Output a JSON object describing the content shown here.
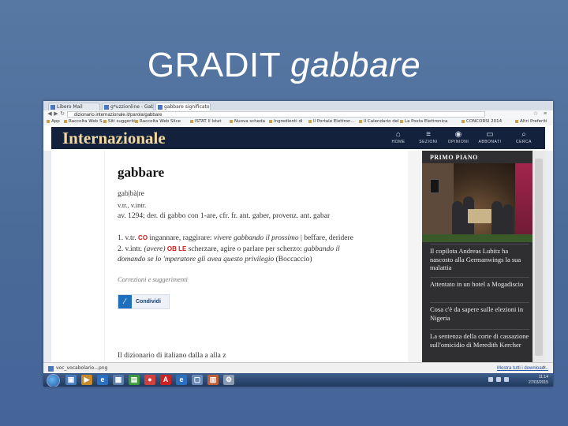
{
  "slide": {
    "title_main": "GRADIT",
    "title_italic": "gabbare"
  },
  "browser": {
    "tabs": [
      {
        "label": "Libero Mail"
      },
      {
        "label": "g*uzzionline - Gab"
      },
      {
        "label": "gabbare significato"
      }
    ],
    "url": "dizionario.internazionale.it/parola/gabbare",
    "bookmarks": [
      "App",
      "Raccolta Web S...",
      "Siti suggeriti",
      "Raccolta Web Slice",
      "ISTAT Il Istat",
      "Nuova scheda",
      "Ingredienti di",
      "Il Portale Elettron...",
      "Il Calendario del",
      "La Posta Elettronica",
      "CONCORSI 2014",
      "Altri Preferiti"
    ]
  },
  "site": {
    "logo": "Internazionale",
    "nav": [
      {
        "label": "HOME",
        "icon": "home-icon",
        "glyph": "⌂"
      },
      {
        "label": "SEZIONI",
        "icon": "menu-icon",
        "glyph": "≡"
      },
      {
        "label": "OPINIONI",
        "icon": "megaphone-icon",
        "glyph": "◉"
      },
      {
        "label": "ABBONATI",
        "icon": "bag-icon",
        "glyph": "▭"
      },
      {
        "label": "CERCA",
        "icon": "search-icon",
        "glyph": "⌕"
      }
    ]
  },
  "article": {
    "headword": "gabbare",
    "pronunciation": "gab|bà|re",
    "grammar": "v.tr., v.intr.",
    "etymology": "av. 1294; der. di gabbo con 1-are, cfr. fr. ant. gaber, provenz. ant. gabar",
    "def1_num": "1. v.tr.",
    "def1_mark": "CO",
    "def1_text": "ingannare, raggirare:",
    "def1_example": "vivere gabbando il prossimo",
    "def1_rest": "| beffare, deridere",
    "def2_num": "2. v.intr.",
    "def2_aux": "(avere)",
    "def2_mark": "OB LE",
    "def2_text": "scherzare, agire o parlare per scherzo:",
    "def2_example": "gabbando il",
    "def2_line2": "domando se lo 'mperatore gli avea questo privilegio",
    "def2_source": "(Boccaccio)",
    "corrections": "Correzioni e suggerimenti",
    "share_label": "Condividi",
    "footer_link": "Il dizionario di italiano dalla a alla z"
  },
  "sidebar": {
    "title": "PRIMO PIANO",
    "items": [
      "Il copilota Andreas Lubitz ha nascosto alla Germanwings la sua malattia",
      "Attentato in un hotel a Mogadiscio",
      "Cosa c'è da sapere sulle elezioni in Nigeria",
      "La sentenza della corte di cassazione sull'omicidio di Meredith Kercher"
    ]
  },
  "downloads": {
    "item": "voc_vocabolario...png",
    "show_all": "Mostra tutti i download..."
  },
  "taskbar": {
    "time": "11:14",
    "date": "27/03/2015"
  },
  "colors": {
    "slide_bg": "#4e6e9c",
    "site_header": "#14213d",
    "logo": "#f1d9a0",
    "mark_red": "#d4191b",
    "share_blue": "#1e6fbd"
  }
}
